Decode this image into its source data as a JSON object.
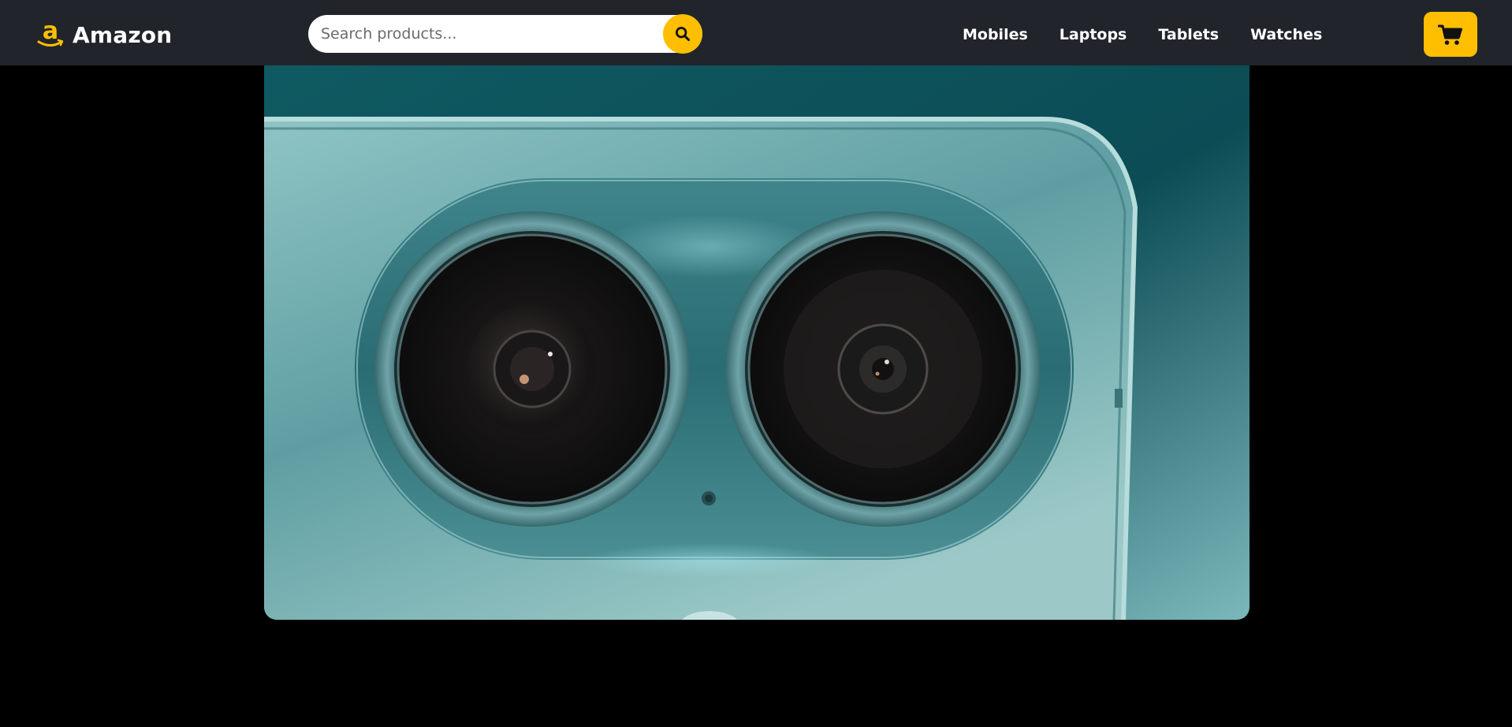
{
  "header": {
    "brand": "Amazon",
    "logo_icon": "amazon-a-smile-icon",
    "accent_color": "#ffbf00",
    "background_color": "#21252b"
  },
  "search": {
    "placeholder": "Search products...",
    "value": "",
    "button_icon": "search-icon"
  },
  "nav": {
    "items": [
      {
        "label": "Mobiles"
      },
      {
        "label": "Laptops"
      },
      {
        "label": "Tablets"
      },
      {
        "label": "Watches"
      }
    ]
  },
  "cart": {
    "icon": "shopping-cart-icon"
  },
  "hero": {
    "image_icon": "phone-dual-camera-closeup",
    "dominant_color": "#2f7f86"
  }
}
